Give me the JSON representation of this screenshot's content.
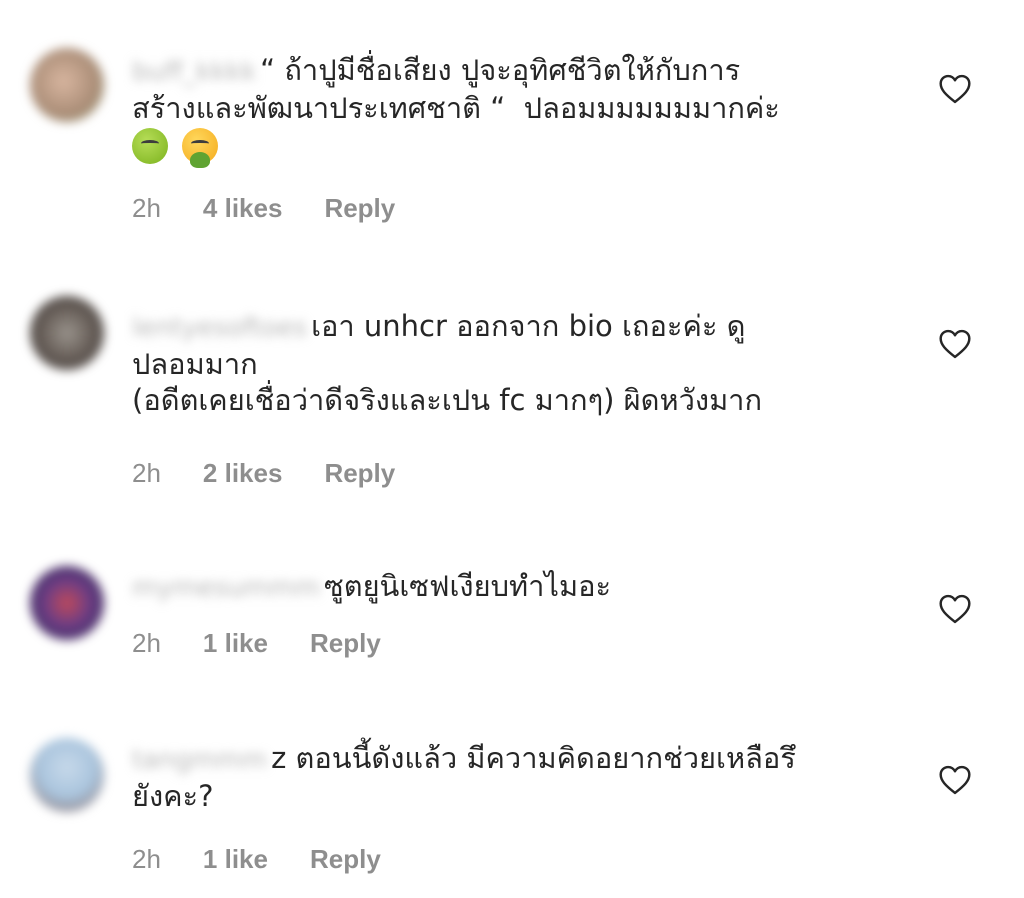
{
  "comments": [
    {
      "username": "buff_kkkk",
      "text": "“ ถ้าปูมีชื่อเสียง ปูจะอุทิศชีวิตให้กับการ\nสร้างและพัฒนาประเทศชาติ “  ปลอมมมมมมมากค่ะ",
      "emojis": [
        "nauseated-face",
        "face-vomiting"
      ],
      "time": "2h",
      "likes": "4 likes",
      "reply": "Reply",
      "avatar_color": "#c9a48e"
    },
    {
      "username": "lentyesoftoes",
      "text": "เอา unhcr ออกจาก bio เถอะค่ะ ดู\nปลอมมาก\n(อดีตเคยเชื่อว่าดีจริงและเปน fc มากๆ) ผิดหวังมาก",
      "emojis": [],
      "time": "2h",
      "likes": "2 likes",
      "reply": "Reply",
      "avatar_color": "#6b625c"
    },
    {
      "username": "mymesummm",
      "text": "ซูตยูนิเซฟเงียบทำไมอะ",
      "emojis": [],
      "time": "2h",
      "likes": "1 like",
      "reply": "Reply",
      "avatar_color": "#5a3a6e"
    },
    {
      "username": "tangmmm",
      "text": "z ตอนนี้ดังแล้ว มีความคิดอยากช่วยเหลือรึ\nยังคะ?",
      "emojis": [],
      "time": "2h",
      "likes": "1 like",
      "reply": "Reply",
      "avatar_color": "#a9c4dd"
    }
  ],
  "icons": {
    "like": "heart-outline-icon"
  }
}
